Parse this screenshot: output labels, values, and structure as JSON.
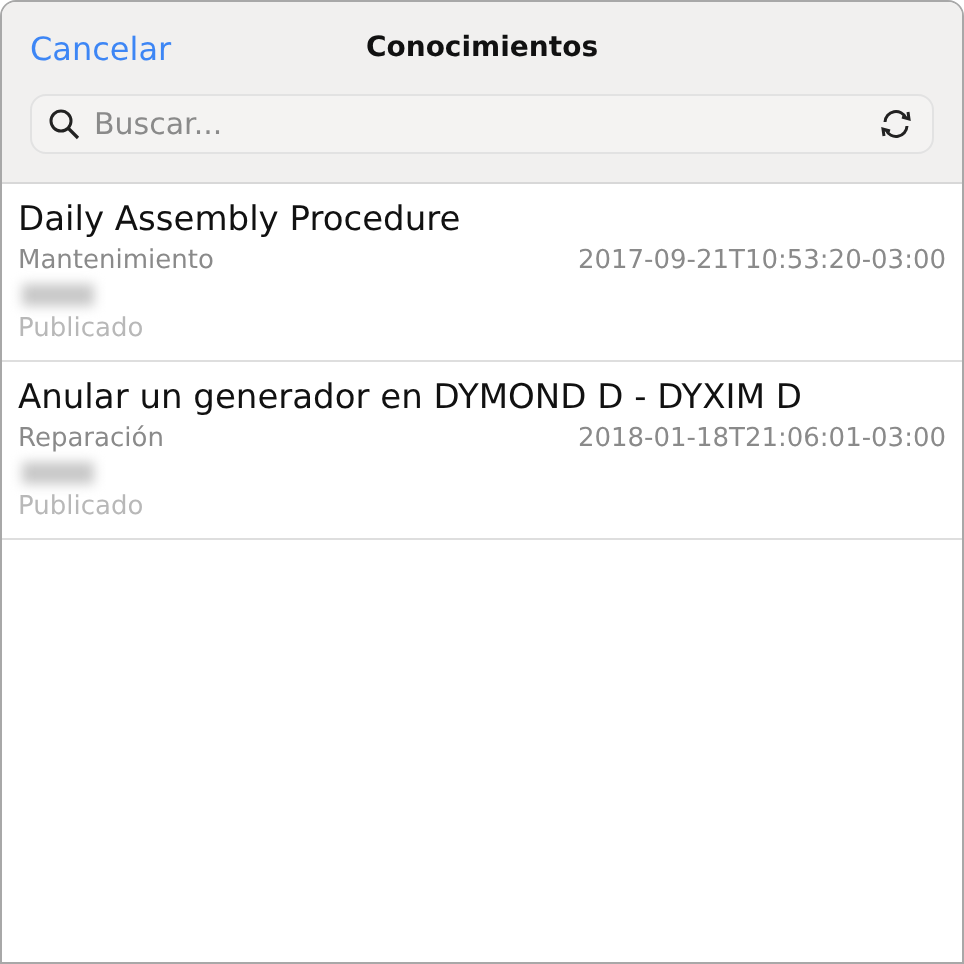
{
  "header": {
    "cancel": "Cancelar",
    "title": "Conocimientos"
  },
  "search": {
    "placeholder": "Buscar..."
  },
  "items": [
    {
      "title": "Daily Assembly Procedure",
      "category": "Mantenimiento",
      "date": "2017-09-21T10:53:20-03:00",
      "status": "Publicado"
    },
    {
      "title": "Anular un generador en DYMOND D - DYXIM D",
      "category": "Reparación",
      "date": "2018-01-18T21:06:01-03:00",
      "status": "Publicado"
    }
  ]
}
